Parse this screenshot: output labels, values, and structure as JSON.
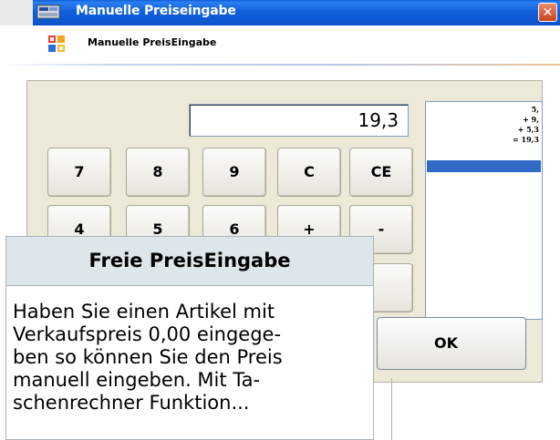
{
  "window": {
    "title": "Manuelle Preiseingabe",
    "close_glyph": "✕"
  },
  "header": {
    "title": "Manuelle PreisEingabe",
    "icon": "windows-logo-icon"
  },
  "calculator": {
    "display_value": "19,3",
    "keys_row1": [
      "7",
      "8",
      "9",
      "C",
      "CE"
    ],
    "keys_row2": [
      "4",
      "5",
      "6",
      "+",
      "-"
    ],
    "tape": [
      "5,",
      "+ 9,",
      "+ 5,3",
      "= 19,3"
    ],
    "ok_label": "OK"
  },
  "help": {
    "title": "Freie PreisEingabe",
    "text": "Haben Sie einen Artikel mit\nVerkaufspreis 0,00 eingege-\nben  so können Sie den Preis\nmanuell eingeben. Mit Ta-\nschenrechner Funktion..."
  },
  "colors": {
    "titlebar": "#0c53c9",
    "panel": "#ece9d8",
    "selection": "#3169c6",
    "help_header": "#dde6eb"
  }
}
